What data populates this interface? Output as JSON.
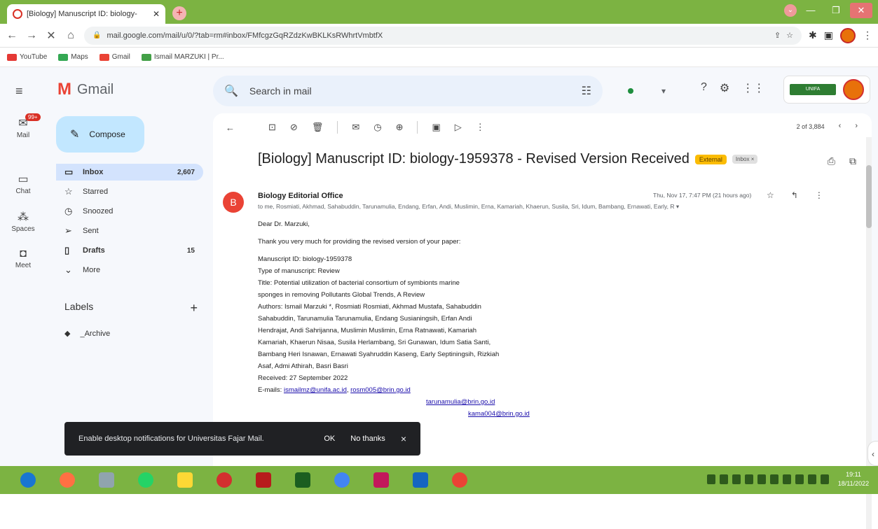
{
  "browser": {
    "tab_title": "[Biology] Manuscript ID: biology-",
    "url": "mail.google.com/mail/u/0/?tab=rm#inbox/FMfcgzGqRZdzKwBKLKsRWhrtVmbtfX",
    "bookmarks": [
      "YouTube",
      "Maps",
      "Gmail",
      "Ismail MARZUKI | Pr..."
    ]
  },
  "gmail": {
    "app_name": "Gmail",
    "rail": [
      {
        "label": "Mail",
        "badge": "99+"
      },
      {
        "label": "Chat"
      },
      {
        "label": "Spaces"
      },
      {
        "label": "Meet"
      }
    ],
    "search_placeholder": "Search in mail",
    "compose_label": "Compose",
    "folders": [
      {
        "label": "Inbox",
        "count": "2,607",
        "icon": "inbox-icon",
        "active": true
      },
      {
        "label": "Starred",
        "count": "",
        "icon": "star-icon"
      },
      {
        "label": "Snoozed",
        "count": "",
        "icon": "clock-icon"
      },
      {
        "label": "Sent",
        "count": "",
        "icon": "send-icon"
      },
      {
        "label": "Drafts",
        "count": "15",
        "icon": "draft-icon"
      },
      {
        "label": "More",
        "count": "",
        "icon": "chevron-down-icon"
      }
    ],
    "labels_heading": "Labels",
    "labels": [
      "_Archive"
    ],
    "pager": "2 of 3,884"
  },
  "email": {
    "subject": "[Biology] Manuscript ID: biology-1959378 - Revised Version Received",
    "chip_external": "External",
    "chip_inbox": "Inbox ×",
    "sender": "Biology Editorial Office",
    "sender_initial": "B",
    "date": "Thu, Nov 17, 7:47 PM (21 hours ago)",
    "recipients": "to me, Rosmiati, Akhmad, Sahabuddin, Tarunamulia, Endang, Erfan, Andi, Muslimin, Erna, Kamariah, Khaerun, Susila, Sri, Idum, Bambang, Ernawati, Early, R",
    "greeting": "Dear Dr. Marzuki,",
    "intro": "Thank you very much for providing the revised version of your paper:",
    "lines": [
      "Manuscript ID: biology-1959378",
      "Type of manuscript: Review",
      "Title: Potential utilization of bacterial consortium of symbionts marine",
      "sponges in removing Pollutants Global Trends, A Review",
      "Authors: Ismail Marzuki *, Rosmiati Rosmiati, Akhmad Mustafa, Sahabuddin",
      "Sahabuddin, Tarunamulia Tarunamulia, Endang Susianingsih, Erfan Andi",
      "Hendrajat, Andi Sahrijanna, Muslimin Muslimin, Erna Ratnawati, Kamariah",
      "Kamariah, Khaerun Nisaa, Susila Herlambang, Sri Gunawan, Idum Satia Santi,",
      "Bambang Heri Isnawan, Ernawati Syahruddin Kaseng, Early Septiningsih, Rizkiah",
      "Asaf, Admi Athirah, Basri Basri",
      "Received: 27 September 2022"
    ],
    "emails_label": "E-mails:",
    "emails": [
      "ismailmz@unifa.ac.id",
      "rosm005@brin.go.id",
      "tarunamulia@brin.go.id",
      "kama004@brin.go.id"
    ]
  },
  "snackbar": {
    "message": "Enable desktop notifications for Universitas Fajar Mail.",
    "ok": "OK",
    "no_thanks": "No thanks",
    "close": "×"
  },
  "taskbar": {
    "time": "19:11",
    "date": "18/11/2022"
  }
}
